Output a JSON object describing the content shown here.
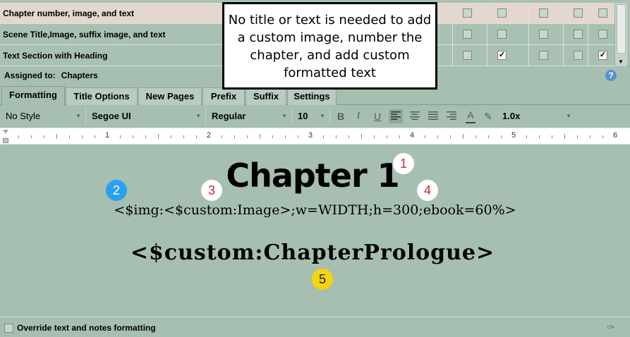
{
  "table": {
    "rows": [
      {
        "label": "Chapter number, image, and text",
        "checks": [
          false,
          false,
          false,
          false,
          false,
          false
        ]
      },
      {
        "label": "Scene Title,Image, suffix image, and text",
        "checks": [
          false,
          false,
          false,
          false,
          false,
          false
        ]
      },
      {
        "label": "Text Section with Heading",
        "checks": [
          false,
          true,
          false,
          false,
          false,
          true
        ]
      }
    ]
  },
  "callout": {
    "text": "No title or text is needed to add a custom image, number the chapter, and add custom formatted text"
  },
  "assigned": {
    "label": "Assigned to:",
    "value": "Chapters"
  },
  "help": {
    "glyph": "?"
  },
  "tabs": [
    {
      "label": "Formatting",
      "active": true
    },
    {
      "label": "Title Options"
    },
    {
      "label": "New Pages"
    },
    {
      "label": "Prefix"
    },
    {
      "label": "Suffix"
    },
    {
      "label": "Settings"
    }
  ],
  "toolbar": {
    "style": "No Style",
    "font": "Segoe UI",
    "weight": "Regular",
    "size": "10",
    "bold": "B",
    "italic": "I",
    "underline": "U",
    "text_color": "A",
    "line_spacing": "1.0x"
  },
  "ruler": {
    "numbers": [
      "1",
      "2",
      "3",
      "4",
      "5",
      "6"
    ]
  },
  "editor": {
    "chapter_title": "Chapter 1",
    "image_code": "<$img:<$custom:Image>;w=WIDTH;h=300;ebook=60%>",
    "prologue": "<$custom:ChapterPrologue>"
  },
  "badges": [
    "1",
    "2",
    "3",
    "4",
    "5"
  ],
  "footer": {
    "override_label": "Override text and notes formatting"
  },
  "colors": {
    "accent_red": "#d32626",
    "accent_blue": "#2aa1ee",
    "accent_yellow": "#f5d40f",
    "background": "#a6bfb1"
  }
}
